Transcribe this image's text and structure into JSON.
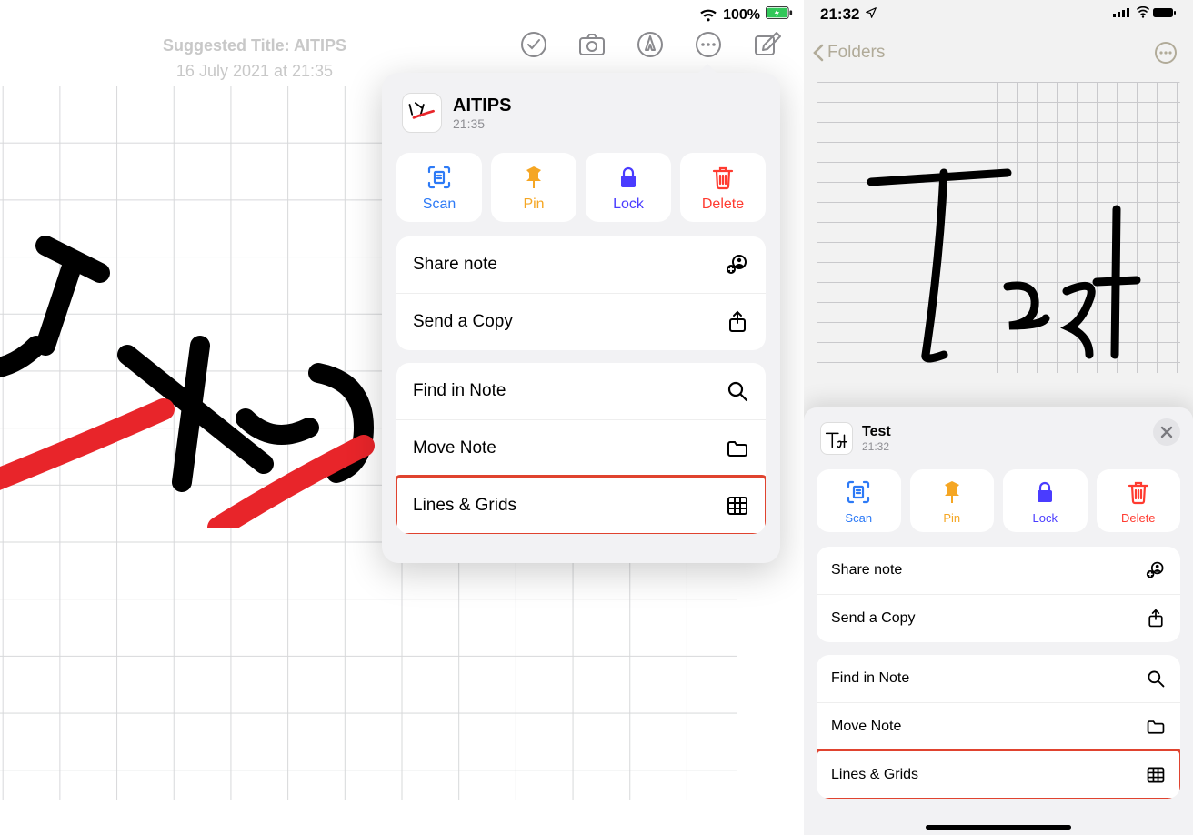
{
  "ipad": {
    "status": {
      "battery_pct": "100%"
    },
    "meta_overlay": {
      "line1": "Suggested Title: AITIPS",
      "line2": "16 July 2021 at 21:35"
    },
    "popover": {
      "title": "AITIPS",
      "time": "21:35",
      "quick": {
        "scan": "Scan",
        "pin": "Pin",
        "lock": "Lock",
        "delete": "Delete"
      },
      "menu": {
        "share": "Share note",
        "send_copy": "Send a Copy",
        "find": "Find in Note",
        "move": "Move Note",
        "lines_grids": "Lines & Grids"
      }
    }
  },
  "iphone": {
    "status": {
      "time": "21:32"
    },
    "nav": {
      "back": "Folders"
    },
    "sheet": {
      "title": "Test",
      "time": "21:32",
      "quick": {
        "scan": "Scan",
        "pin": "Pin",
        "lock": "Lock",
        "delete": "Delete"
      },
      "menu": {
        "share": "Share note",
        "send_copy": "Send a Copy",
        "find": "Find in Note",
        "move": "Move Note",
        "lines_grids": "Lines & Grids"
      }
    }
  }
}
